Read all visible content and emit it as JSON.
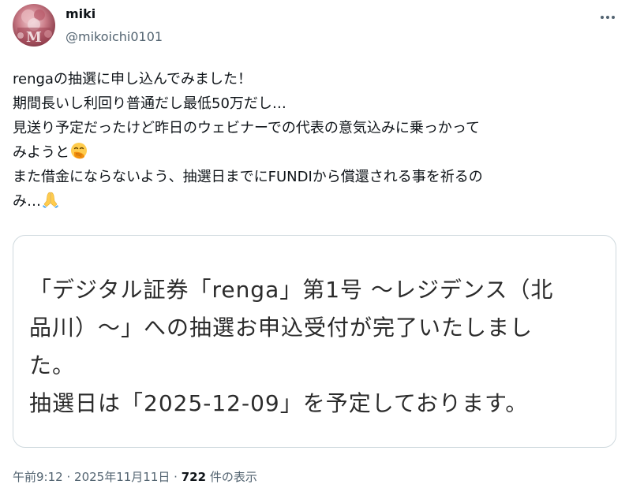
{
  "author": {
    "display_name": "miki",
    "handle": "@mikoichi0101"
  },
  "tweet": {
    "lines": [
      "rengaの抽選に申し込んでみました！",
      "期間長いし利回り普通だし最低50万だし…",
      "見送り予定だったけど昨日のウェビナーでの代表の意気込みに乗っかって",
      "みようと",
      "また借金にならないよう、抽選日までにFUNDIから償還される事を祈るの",
      "み…"
    ],
    "emoji_1": "face-with-hand-over-mouth",
    "emoji_2": "folded-hands"
  },
  "card": {
    "lines": [
      "「デジタル証券「renga」第1号 〜レジデンス（北",
      "品川）〜」への抽選お申込受付が完了いたしまし",
      "た。",
      "抽選日は「2025-12-09」を予定しております。"
    ]
  },
  "meta": {
    "time": "午前9:12",
    "separator_1": "·",
    "date": "2025年11月11日",
    "separator_2": "·",
    "views_count": "722",
    "views_label": "件の表示"
  },
  "colors": {
    "text_primary": "#0f1419",
    "text_secondary": "#536471",
    "border": "#cfd9de",
    "card_text": "#2b2b2b"
  }
}
